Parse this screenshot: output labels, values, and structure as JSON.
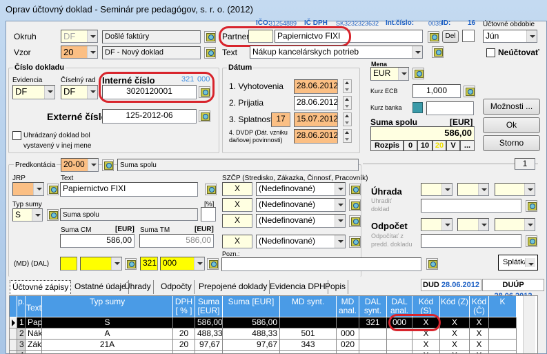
{
  "window": {
    "title": "Oprav účtovný doklad - Seminár pre pedagógov, s. r. o. (2012)"
  },
  "info": {
    "ico_label": "IČO:",
    "ico": "31254889",
    "icdph_label": "IČ DPH",
    "icdph": "SK3232323632",
    "int_cislo_label": "Int.číslo:",
    "int_cislo": "0039",
    "id_label": "ID:",
    "id": "16"
  },
  "header": {
    "okruh_label": "Okruh",
    "okruh_code": "DF",
    "okruh_name": "Došlé faktúry",
    "vzor_label": "Vzor",
    "vzor_code": "20",
    "vzor_name": "DF - Nový doklad",
    "partner_label": "Partner",
    "partner_code": "",
    "partner_name": "Papiernictvo FIXI",
    "del_label": "Del",
    "text_label": "Text",
    "text_value": "Nákup kancelárskych potrieb",
    "obdobie_label": "Účtovné obdobie",
    "obdobie_value": "Jún",
    "neuctovat_label": "Neúčtovať",
    "neuctovat_checked": false
  },
  "cislo_dokladu": {
    "title": "Číslo dokladu",
    "evidencia_label": "Evidencia",
    "evidencia": "DF",
    "ciselny_rad_label": "Číselný rad",
    "ciselny_rad": "DF",
    "interne_label": "Interné číslo",
    "interne_account": "321",
    "interne_anal": "000",
    "interne": "3020120001",
    "externe_label": "Externé číslo",
    "externe": "125-2012-06",
    "mena_checkbox_line1": "Uhrádzaný doklad bol",
    "mena_checkbox_line2": "vystavený v inej mene"
  },
  "datum": {
    "title": "Dátum",
    "vyhotovenia_label": "1. Vyhotovenia",
    "vyhotovenia": "28.06.2012",
    "prijatia_label": "2. Prijatia",
    "prijatia": "28.06.2012",
    "splatnosti_label": "3. Splatnosti",
    "splatnosti_days": "17",
    "splatnosti": "15.07.2012",
    "dvdp_label1": "4. DVDP (Dát. vzniku",
    "dvdp_label2": "daňovej povinnosti)",
    "dvdp": "28.06.2012"
  },
  "mena": {
    "label": "Mena",
    "value": "EUR",
    "kurz_ecb_label": "Kurz ECB",
    "kurz_ecb": "1,000",
    "kurz_banka_label": "Kurz banka",
    "kurz_banka": "",
    "suma_label": "Suma spolu",
    "suma_unit": "[EUR]",
    "suma": "586,00",
    "buttons": [
      "Rozpis",
      "0",
      "10",
      "20",
      "V",
      "..."
    ]
  },
  "actions": {
    "moznosti": "Možnosti ...",
    "ok": "Ok",
    "storno": "Storno"
  },
  "page_counter": "1",
  "polozka": {
    "predkontacia_label": "Predkontácia",
    "predkontacia": "20-00",
    "predkontacia_name": "Suma spolu",
    "jrp_label": "JRP",
    "jrp": "",
    "text_label": "Text",
    "text": "Papiernictvo FIXI",
    "typ_sumy_label": "Typ sumy",
    "typ_sumy": "S",
    "typ_sumy_name": "Suma spolu",
    "percent_label": "[%]",
    "percent": "",
    "suma_cm_label": "Suma CM",
    "suma_cm_unit": "[EUR]",
    "suma_cm": "586,00",
    "suma_tm_label": "Suma TM",
    "suma_tm_unit": "[EUR]",
    "suma_tm": "586,00",
    "szcp_label": "SZČP (Stredisko, Zákazka, Činnosť, Pracovník)",
    "szcp": [
      {
        "code": "X",
        "name": "(Nedefinované)"
      },
      {
        "code": "X",
        "name": "(Nedefinované)"
      },
      {
        "code": "X",
        "name": "(Nedefinované)"
      },
      {
        "code": "X",
        "name": "(Nedefinované)"
      }
    ],
    "md_dal_label": "(MD) (DAL)",
    "md_synt": "",
    "md_anal": "",
    "dal_synt": "321",
    "dal_anal": "000",
    "pozn_label": "Pozn.:",
    "pozn": "",
    "uhrada_label": "Úhrada",
    "uhradit_label1": "Uhradiť",
    "uhradit_label2": "doklad",
    "odpocet_label": "Odpočet",
    "odpocitat_label1": "Odpočítať z",
    "odpocitat_label2": "predd. dokladu",
    "splatka": "Splátka"
  },
  "tabs": [
    "Účtovné zápisy",
    "Ostatné údaje",
    "Úhrady",
    "Odpočty",
    "Prepojené doklady",
    "Evidencia DPH",
    "Popis"
  ],
  "dud": {
    "label": "DUD",
    "value": "28.06.2012"
  },
  "duup": {
    "label": "DUÚP",
    "value": "28.06.2012"
  },
  "grid": {
    "columns": [
      "p.č.",
      "Text",
      "Typ sumy",
      "DPH [ % ]",
      "Suma [EUR]",
      "Suma [EUR]",
      "MD synt.",
      "MD anal.",
      "DAL synt.",
      "DAL anal.",
      "Kód (S)",
      "Kód (Z)",
      "Kód (Č)",
      "K"
    ],
    "rows": [
      [
        "1",
        "Papiernictvo FIXI",
        "S",
        "",
        "586,00",
        "586,00",
        "",
        "",
        "321",
        "000",
        "X",
        "X",
        "X",
        ""
      ],
      [
        "2",
        "Nákup kancelárskych potrieb",
        "A",
        "20",
        "488,33",
        "488,33",
        "501",
        "000",
        "",
        "",
        "X",
        "X",
        "X",
        ""
      ],
      [
        "3",
        "Základná sadzba DPH - DPH",
        "21A",
        "20",
        "97,67",
        "97,67",
        "343",
        "020",
        "",
        "",
        "X",
        "X",
        "X",
        ""
      ],
      [
        "4",
        "",
        "",
        "",
        "",
        "",
        "",
        "",
        "",
        "",
        "X",
        "X",
        "X",
        ""
      ]
    ],
    "selected_row": 0
  },
  "colors": {
    "highlight": "#d8242c",
    "orange_field": "#fbbf84",
    "yellow_field": "#ffffe1",
    "grid_header": "#4a9be6"
  }
}
